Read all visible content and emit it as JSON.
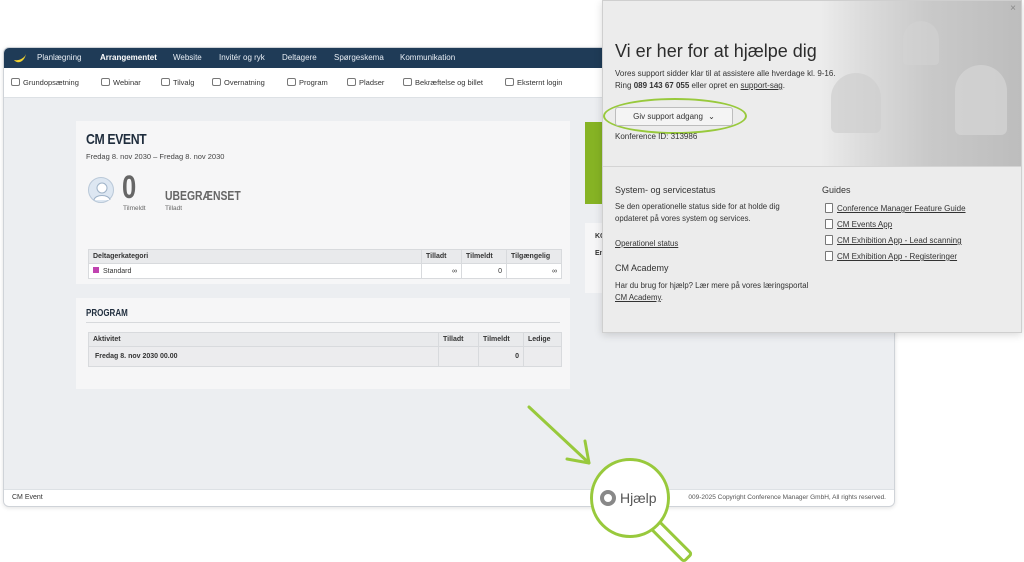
{
  "colors": {
    "nav_bg": "#1f3b57",
    "accent_green": "#98c93c",
    "category_swatch": "#c043b0"
  },
  "topnav": {
    "items": [
      "Planlægning",
      "Arrangementet",
      "Website",
      "Invitér og ryk",
      "Deltagere",
      "Spørgeskema",
      "Kommunikation"
    ],
    "active": "Arrangementet"
  },
  "subnav": {
    "items": [
      "Grundopsætning",
      "Webinar",
      "Tilvalg",
      "Overnatning",
      "Program",
      "Pladser",
      "Bekræftelse og billet",
      "Eksternt login"
    ]
  },
  "event": {
    "title": "CM EVENT",
    "dates": "Fredag 8. nov 2030 – Fredag 8. nov 2030",
    "registered_count": "0",
    "registered_label": "Tilmeldt",
    "allowed_value": "UBEGRÆNSET",
    "allowed_label": "Tilladt"
  },
  "category_table": {
    "headers": [
      "Deltagerkategori",
      "Tilladt",
      "Tilmeldt",
      "Tilgængelig"
    ],
    "rows": [
      [
        "Standard",
        "∞",
        "0",
        "∞"
      ]
    ]
  },
  "program": {
    "title": "PROGRAM",
    "headers": [
      "Aktivitet",
      "Tilladt",
      "Tilmeldt",
      "Ledige"
    ],
    "rows": [
      [
        "Fredag 8. nov 2030 00.00",
        "",
        "0",
        ""
      ]
    ]
  },
  "side_card": {
    "label1": "KOL",
    "label2": "En"
  },
  "footer": {
    "left": "CM Event",
    "right": "009-2025 Copyright Conference Manager GmbH, All rights reserved."
  },
  "popup": {
    "close": "×",
    "title": "Vi er her for at hjælpe dig",
    "desc_line1": "Vores support sidder klar til at assistere alle hverdage kl. 9-16.",
    "desc_ring": "Ring",
    "phone": "089 143 67 055",
    "desc_or": "eller opret en",
    "support_link": "support-sag",
    "support_button": "Giv support adgang",
    "conference_id": "Konference ID: 313986",
    "status_title": "System- og servicestatus",
    "status_text": "Se den operationelle status side for at holde dig opdateret på vores system og services.",
    "status_link": "Operationel status",
    "academy_title": "CM Academy",
    "academy_text": "Har du brug for hjælp? Lær mere på vores læringsportal",
    "academy_link": "CM Academy",
    "guides_title": "Guides",
    "guides": [
      "Conference Manager Feature Guide",
      "CM Events App",
      "CM Exhibition App - Lead scanning",
      "CM Exhibition App - Registeringer"
    ]
  },
  "help": {
    "label": "Hjælp"
  }
}
